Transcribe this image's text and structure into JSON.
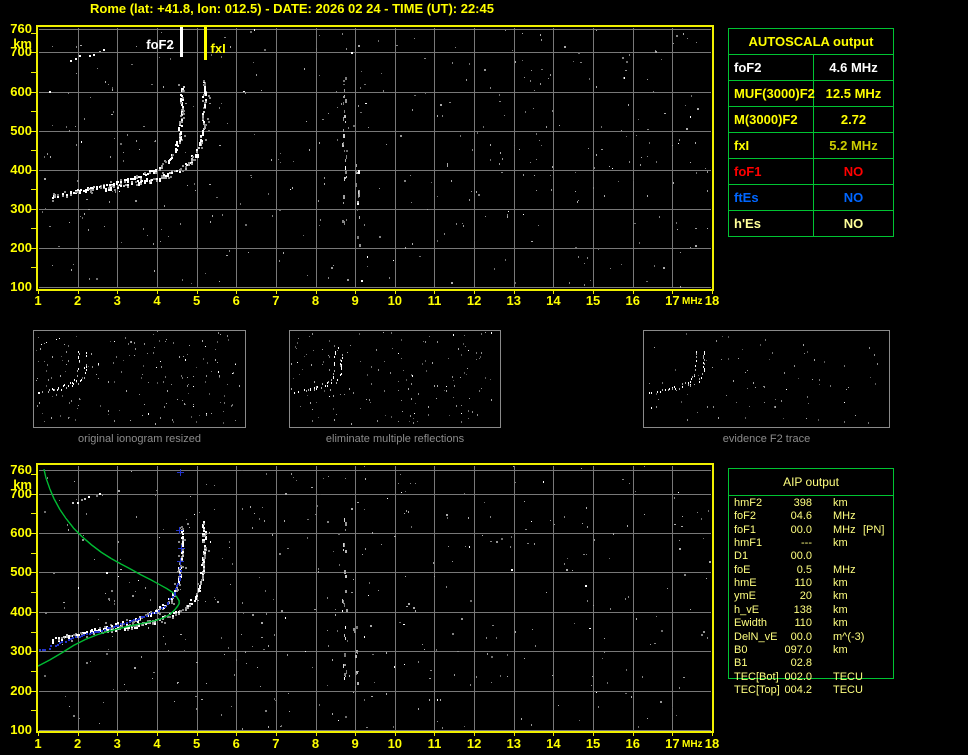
{
  "title": "Rome (lat: +41.8, lon: 012.5) - DATE: 2026 02 24 - TIME (UT): 22:45",
  "colors": {
    "background": "#000000",
    "axis_yellow": "#F0F000",
    "label_yellow": "#FFFF00",
    "grid_gray": "#787878",
    "table_border_green": "#00C432",
    "pale_yellow": "#FFFF80",
    "profile_green": "#00BB33",
    "restored_blue": "#2233CC",
    "alert_red": "#FF0000",
    "es_blue": "#0066FF",
    "white": "#FFFFFF",
    "fxi_value_yellow": "#CCCC00",
    "caption_gray": "#8C8C8C"
  },
  "autoscala_table": {
    "header": "AUTOSCALA output",
    "rows": [
      {
        "param": "foF2",
        "value": "4.6 MHz",
        "color": "#FFFFFF"
      },
      {
        "param": "MUF(3000)F2",
        "value": "12.5 MHz",
        "color": "#FFFF00"
      },
      {
        "param": "M(3000)F2",
        "value": "2.72",
        "color": "#FFFF00"
      },
      {
        "param": "fxI",
        "value": "5.2 MHz",
        "color": "#FFFF00",
        "value_color": "#CCCC00"
      },
      {
        "param": "foF1",
        "value": "NO",
        "color": "#FF0000"
      },
      {
        "param": "ftEs",
        "value": "NO",
        "color": "#0066FF"
      },
      {
        "param": "h'Es",
        "value": "NO",
        "color": "#FFFF99"
      }
    ]
  },
  "aip_table": {
    "header": "AIP output",
    "rows": [
      {
        "param": "hmF2",
        "value": "398",
        "unit": "km",
        "note": ""
      },
      {
        "param": "foF2",
        "value": "04.6",
        "unit": "MHz",
        "note": ""
      },
      {
        "param": "foF1",
        "value": "00.0",
        "unit": "MHz",
        "note": "[PN]"
      },
      {
        "param": "hmF1",
        "value": "---",
        "unit": "km",
        "note": ""
      },
      {
        "param": "D1",
        "value": "00.0",
        "unit": "",
        "note": ""
      },
      {
        "param": "foE",
        "value": "0.5",
        "unit": "MHz",
        "note": ""
      },
      {
        "param": "hmE",
        "value": "110",
        "unit": "km",
        "note": ""
      },
      {
        "param": "ymE",
        "value": "20",
        "unit": "km",
        "note": ""
      },
      {
        "param": "h_vE",
        "value": "138",
        "unit": "km",
        "note": ""
      },
      {
        "param": "Ewidth",
        "value": "110",
        "unit": "km",
        "note": ""
      },
      {
        "param": "DelN_vE",
        "value": "00.0",
        "unit": "m^(-3)",
        "note": ""
      },
      {
        "param": "B0",
        "value": "097.0",
        "unit": "km",
        "note": ""
      },
      {
        "param": "B1",
        "value": "02.8",
        "unit": "",
        "note": ""
      },
      {
        "param": "TEC[Bot]",
        "value": "002.0",
        "unit": "TECU",
        "note": ""
      },
      {
        "param": "TEC[Top]",
        "value": "004.2",
        "unit": "TECU",
        "note": ""
      }
    ]
  },
  "thumbnails": {
    "items": [
      {
        "caption": "original ionogram resized",
        "noise_dots": 170,
        "has_second_hop": true
      },
      {
        "caption": "eliminate multiple reflections",
        "noise_dots": 150,
        "has_second_hop": false
      },
      {
        "caption": "evidence F2 trace",
        "noise_dots": 80,
        "has_second_hop": false
      }
    ]
  },
  "chart_data": [
    {
      "name": "top_ionogram",
      "type": "scatter",
      "title": "",
      "xlabel": "MHz",
      "ylabel": "km",
      "xlim": [
        1,
        18
      ],
      "ylim": [
        100,
        760
      ],
      "grid": true,
      "xticks": [
        1,
        2,
        3,
        4,
        5,
        6,
        7,
        8,
        9,
        10,
        11,
        12,
        13,
        14,
        15,
        16,
        17,
        18
      ],
      "yticks": [
        760,
        700,
        600,
        500,
        400,
        300,
        200,
        100
      ],
      "markers": [
        {
          "label": "foF2",
          "freq_mhz": 4.6,
          "color": "#FFFFFF"
        },
        {
          "label": "fxI",
          "freq_mhz": 5.2,
          "color": "#FFFF00"
        }
      ],
      "series": [
        {
          "name": "F2 trace ordinary mode",
          "points": [
            [
              1.35,
              328
            ],
            [
              1.5,
              332
            ],
            [
              1.7,
              336
            ],
            [
              1.9,
              341
            ],
            [
              2.1,
              346
            ],
            [
              2.3,
              350
            ],
            [
              2.5,
              355
            ],
            [
              2.7,
              360
            ],
            [
              2.9,
              365
            ],
            [
              3.1,
              370
            ],
            [
              3.3,
              376
            ],
            [
              3.5,
              382
            ],
            [
              3.7,
              389
            ],
            [
              3.9,
              397
            ],
            [
              4.05,
              405
            ],
            [
              4.2,
              415
            ],
            [
              4.3,
              425
            ],
            [
              4.4,
              437
            ],
            [
              4.47,
              450
            ],
            [
              4.52,
              465
            ],
            [
              4.56,
              482
            ],
            [
              4.59,
              505
            ],
            [
              4.61,
              530
            ],
            [
              4.63,
              558
            ],
            [
              4.64,
              588
            ],
            [
              4.65,
              615
            ]
          ]
        },
        {
          "name": "F2 trace extraordinary mode",
          "points": [
            [
              2.6,
              352
            ],
            [
              2.8,
              355
            ],
            [
              3.0,
              358
            ],
            [
              3.2,
              361
            ],
            [
              3.4,
              365
            ],
            [
              3.6,
              369
            ],
            [
              3.8,
              374
            ],
            [
              4.0,
              379
            ],
            [
              4.2,
              386
            ],
            [
              4.4,
              394
            ],
            [
              4.55,
              401
            ],
            [
              4.7,
              409
            ],
            [
              4.8,
              417
            ],
            [
              4.9,
              427
            ],
            [
              5.0,
              440
            ],
            [
              5.07,
              455
            ],
            [
              5.12,
              472
            ],
            [
              5.15,
              492
            ],
            [
              5.17,
              515
            ],
            [
              5.19,
              545
            ],
            [
              5.2,
              575
            ],
            [
              5.21,
              605
            ],
            [
              5.21,
              625
            ]
          ]
        },
        {
          "name": "second hop echo",
          "points": [
            [
              1.6,
              668
            ],
            [
              1.8,
              676
            ],
            [
              2.0,
              683
            ],
            [
              2.2,
              690
            ],
            [
              2.4,
              696
            ],
            [
              2.6,
              701
            ],
            [
              2.8,
              706
            ],
            [
              3.0,
              710
            ]
          ]
        }
      ],
      "noise_columns": [
        {
          "freq_mhz": 8.72,
          "km_range": [
            260,
            660
          ],
          "dots": 30
        },
        {
          "freq_mhz": 9.05,
          "km_range": [
            200,
            420
          ],
          "dots": 16
        }
      ],
      "background_noise": {
        "dot_count": 380,
        "seed": 1234
      }
    },
    {
      "name": "bottom_ionogram",
      "type": "scatter",
      "title": "",
      "xlabel": "MHz",
      "ylabel": "km",
      "xlim": [
        1,
        18
      ],
      "ylim": [
        100,
        760
      ],
      "grid": true,
      "xticks": [
        1,
        2,
        3,
        4,
        5,
        6,
        7,
        8,
        9,
        10,
        11,
        12,
        13,
        14,
        15,
        16,
        17,
        18
      ],
      "yticks": [
        760,
        700,
        600,
        500,
        400,
        300,
        200,
        100
      ],
      "series": [
        {
          "name": "F2 trace ordinary mode",
          "points": [
            [
              1.35,
              328
            ],
            [
              1.5,
              332
            ],
            [
              1.7,
              336
            ],
            [
              1.9,
              341
            ],
            [
              2.1,
              346
            ],
            [
              2.3,
              350
            ],
            [
              2.5,
              355
            ],
            [
              2.7,
              360
            ],
            [
              2.9,
              365
            ],
            [
              3.1,
              370
            ],
            [
              3.3,
              376
            ],
            [
              3.5,
              382
            ],
            [
              3.7,
              389
            ],
            [
              3.9,
              397
            ],
            [
              4.05,
              405
            ],
            [
              4.2,
              415
            ],
            [
              4.3,
              425
            ],
            [
              4.4,
              437
            ],
            [
              4.47,
              450
            ],
            [
              4.52,
              465
            ],
            [
              4.56,
              482
            ],
            [
              4.59,
              505
            ],
            [
              4.61,
              530
            ],
            [
              4.63,
              558
            ],
            [
              4.64,
              588
            ],
            [
              4.65,
              615
            ]
          ]
        },
        {
          "name": "F2 trace extraordinary mode",
          "points": [
            [
              2.6,
              352
            ],
            [
              2.8,
              355
            ],
            [
              3.0,
              358
            ],
            [
              3.2,
              361
            ],
            [
              3.4,
              365
            ],
            [
              3.6,
              369
            ],
            [
              3.8,
              374
            ],
            [
              4.0,
              379
            ],
            [
              4.2,
              386
            ],
            [
              4.4,
              394
            ],
            [
              4.55,
              401
            ],
            [
              4.7,
              409
            ],
            [
              4.8,
              417
            ],
            [
              4.9,
              427
            ],
            [
              5.0,
              440
            ],
            [
              5.07,
              455
            ],
            [
              5.12,
              472
            ],
            [
              5.15,
              492
            ],
            [
              5.17,
              515
            ],
            [
              5.19,
              545
            ],
            [
              5.2,
              575
            ],
            [
              5.21,
              605
            ],
            [
              5.21,
              625
            ]
          ]
        },
        {
          "name": "second hop echo",
          "points": [
            [
              1.9,
              672
            ],
            [
              2.1,
              680
            ],
            [
              2.3,
              688
            ],
            [
              2.5,
              695
            ],
            [
              2.7,
              701
            ]
          ]
        }
      ],
      "profile": {
        "name": "AIP electron density profile",
        "color": "#00BB33",
        "points": [
          [
            1.0,
            262
          ],
          [
            1.3,
            278
          ],
          [
            1.6,
            296
          ],
          [
            1.9,
            315
          ],
          [
            2.2,
            330
          ],
          [
            2.5,
            342
          ],
          [
            2.8,
            351
          ],
          [
            3.1,
            359
          ],
          [
            3.4,
            366
          ],
          [
            3.7,
            372
          ],
          [
            4.0,
            379
          ],
          [
            4.2,
            386
          ],
          [
            4.35,
            395
          ],
          [
            4.45,
            405
          ],
          [
            4.52,
            414
          ],
          [
            4.56,
            421
          ],
          [
            4.56,
            428
          ],
          [
            4.5,
            438
          ],
          [
            4.4,
            449
          ],
          [
            4.25,
            459
          ],
          [
            4.05,
            470
          ],
          [
            3.85,
            481
          ],
          [
            3.6,
            494
          ],
          [
            3.35,
            508
          ],
          [
            3.1,
            521
          ],
          [
            2.85,
            535
          ],
          [
            2.6,
            551
          ],
          [
            2.35,
            570
          ],
          [
            2.1,
            592
          ],
          [
            1.9,
            612
          ],
          [
            1.7,
            638
          ],
          [
            1.55,
            660
          ],
          [
            1.4,
            688
          ],
          [
            1.3,
            712
          ],
          [
            1.2,
            740
          ],
          [
            1.15,
            762
          ]
        ]
      },
      "restored_trace": {
        "name": "AUTOSCALA restored F2 trace",
        "color": "#2233CC",
        "points": [
          [
            1.05,
            300
          ],
          [
            1.2,
            305
          ],
          [
            1.35,
            311
          ],
          [
            1.5,
            317
          ],
          [
            1.7,
            324
          ],
          [
            1.9,
            331
          ],
          [
            2.1,
            338
          ],
          [
            2.3,
            344
          ],
          [
            2.5,
            350
          ],
          [
            2.7,
            356
          ],
          [
            2.9,
            362
          ],
          [
            3.1,
            368
          ],
          [
            3.3,
            374
          ],
          [
            3.5,
            380
          ],
          [
            3.7,
            387
          ],
          [
            3.9,
            395
          ],
          [
            4.05,
            403
          ],
          [
            4.2,
            413
          ],
          [
            4.3,
            423
          ],
          [
            4.4,
            435
          ],
          [
            4.47,
            448
          ],
          [
            4.52,
            463
          ],
          [
            4.56,
            480
          ],
          [
            4.58,
            496
          ],
          [
            4.6,
            510
          ]
        ],
        "plus_marks": [
          [
            4.57,
            530
          ],
          [
            4.6,
            562
          ],
          [
            4.55,
            608
          ],
          [
            4.59,
            755
          ]
        ]
      },
      "noise_columns": [
        {
          "freq_mhz": 8.72,
          "km_range": [
            230,
            640
          ],
          "dots": 28
        },
        {
          "freq_mhz": 9.0,
          "km_range": [
            200,
            380
          ],
          "dots": 12
        }
      ],
      "background_noise": {
        "dot_count": 380,
        "seed": 4321
      }
    }
  ]
}
